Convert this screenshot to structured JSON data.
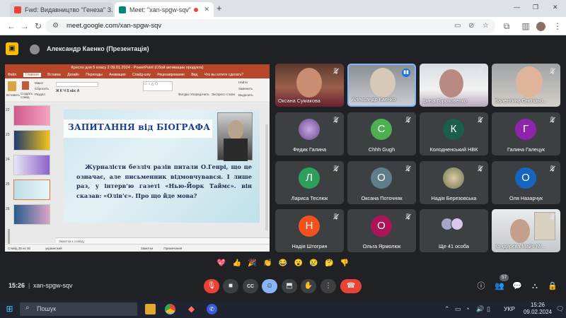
{
  "browser": {
    "tabs": [
      {
        "label": "Fwd: Видавництво \"Генеза\" З...",
        "active": false,
        "icon": "gmail-icon",
        "color": "#ea4335"
      },
      {
        "label": "Meet: \"xan-spgw-sqv\"",
        "active": true,
        "icon": "meet-icon",
        "color": "#00897b"
      }
    ],
    "new_tab": "+",
    "window_controls": {
      "minimize": "—",
      "maximize": "❐",
      "close": "✕"
    },
    "url": "meet.google.com/xan-spgw-sqv"
  },
  "meet": {
    "presenter_label": "Александр Каенко (Презентація)",
    "presentation": {
      "window_title": "Кресло для 5 класу 2 09.01.2024 - PowerPoint (Сбой активации продукта)",
      "ribbon_tabs": [
        "Файл",
        "Главная",
        "Вставка",
        "Дизайн",
        "Переходы",
        "Анимация",
        "Слайд-шоу",
        "Рецензирование",
        "Вид",
        "Что вы хотите сделать?"
      ],
      "ribbon_labels": [
        "Вставить",
        "Создать слайд",
        "Макет",
        "Сбросить",
        "Раздел",
        "Фигуры",
        "Упорядочить",
        "Экспресс-стили",
        "Найти",
        "Заменить",
        "Выделить"
      ],
      "thumb_numbers": [
        "22",
        "23",
        "24",
        "25",
        "26"
      ],
      "slide_title": "ЗАПИТАННЯ від БІОГРАФА",
      "slide_body": "Журналісти безліч разів питали О.Генрі, що це означає, але письменник відмовчувався. І лише раз, у інтерв'ю газеті «Нью-Йорк Таймс». він сказав: «Олів'є». Про що йде мова?",
      "notes_placeholder": "Заметки к слайду",
      "status_left": "Слайд 25 из 36",
      "status_lang": "украинский",
      "status_notes": "Заметки",
      "status_comments": "Примечания"
    },
    "participants": [
      {
        "name": "Оксана Сумакова",
        "type": "video",
        "muted": true
      },
      {
        "name": "Александр Каенко",
        "type": "video",
        "muted": false
      },
      {
        "name": "Ірина Гороховенко",
        "type": "video",
        "muted": true
      },
      {
        "name": "Валентина Снєгірьо...",
        "type": "video",
        "muted": true
      },
      {
        "name": "Федик Галина",
        "type": "photo",
        "muted": true
      },
      {
        "name": "Chhh Gugh",
        "type": "initial",
        "initial": "C",
        "color": "#4caf50",
        "muted": true
      },
      {
        "name": "Колодненський НВК",
        "type": "initial",
        "initial": "К",
        "color": "#1b5e4a",
        "muted": true
      },
      {
        "name": "Галина Галецук",
        "type": "initial",
        "initial": "Г",
        "color": "#8e24aa",
        "muted": true
      },
      {
        "name": "Лариса Теслюк",
        "type": "initial",
        "initial": "Л",
        "color": "#2e9e5b",
        "muted": true
      },
      {
        "name": "Оксана Поточняк",
        "type": "initial",
        "initial": "О",
        "color": "#607d8b",
        "muted": true
      },
      {
        "name": "Надія Березовська",
        "type": "photo",
        "muted": true
      },
      {
        "name": "Оля Назарчук",
        "type": "initial",
        "initial": "О",
        "color": "#1565c0",
        "muted": true
      },
      {
        "name": "Надія Штогрин",
        "type": "initial",
        "initial": "Н",
        "color": "#f4511e",
        "muted": true
      },
      {
        "name": "Ольга Ярмолюк",
        "type": "initial",
        "initial": "О",
        "color": "#ad1457",
        "muted": true
      },
      {
        "name": "Ще 41 особа",
        "type": "more"
      },
      {
        "name": "Кондирєва Майя Мі...",
        "type": "video",
        "muted": true
      }
    ],
    "reactions": [
      "💖",
      "👍",
      "🎉",
      "👏",
      "😂",
      "😮",
      "😢",
      "🤔",
      "👎"
    ],
    "time": "15:26",
    "meeting_code": "xan-spgw-sqv",
    "people_count": "57",
    "accent": "#ea4335"
  },
  "taskbar": {
    "search_placeholder": "Пошук",
    "language": "УКР",
    "clock_time": "15:26",
    "clock_date": "09.02.2024"
  }
}
